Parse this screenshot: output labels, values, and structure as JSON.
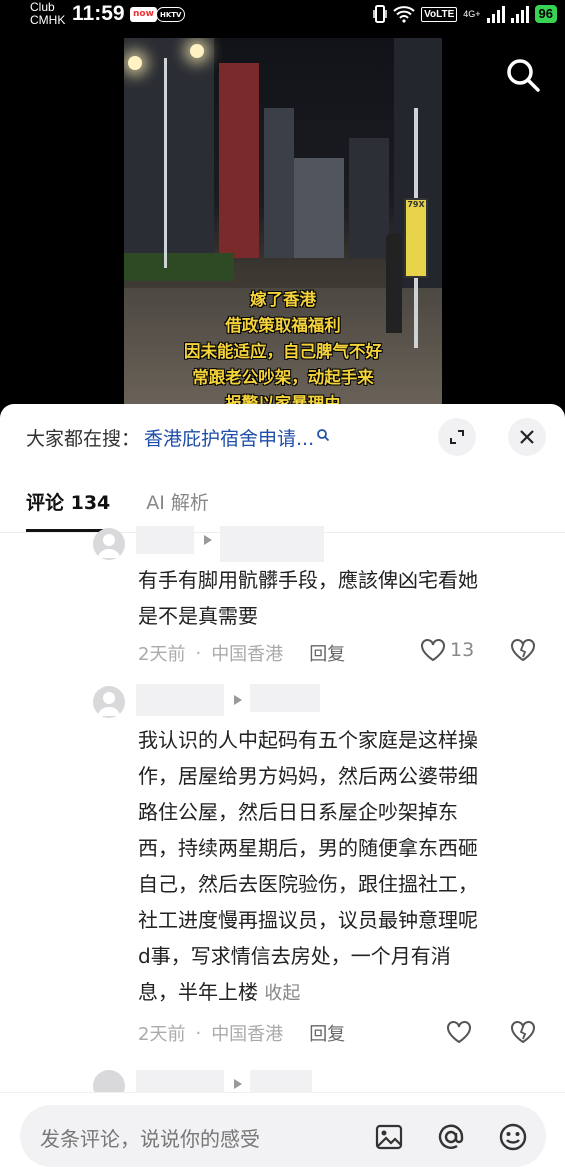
{
  "status_bar": {
    "carrier_line1": "Club",
    "carrier_line2": "CMHK",
    "time": "11:59",
    "app_badge_1": "now",
    "app_badge_2": "HKTV",
    "volte": "VoLTE",
    "network": "4G+",
    "battery": "96"
  },
  "video": {
    "subtitles": [
      "嫁了香港",
      "借政策取福福利",
      "因未能适应，自己脾气不好",
      "常跟老公吵架，动起手来",
      "报警以家暴理由"
    ],
    "sign_text": "79X"
  },
  "sheet": {
    "hot_search_label": "大家都在搜：",
    "hot_search_query": "香港庇护宿舍申请...",
    "tabs": [
      {
        "label": "评论 134",
        "active": true
      },
      {
        "label": "AI 解析",
        "active": false
      }
    ]
  },
  "comments": [
    {
      "text": "有手有脚用骯髒手段，應該俾凶宅看她是不是真需要",
      "line1": "有手有脚用骯髒手段，應該俾凶宅看她",
      "line2": "是不是真需要",
      "time": "2天前",
      "location": "中国香港",
      "reply_label": "回复",
      "likes": "13"
    },
    {
      "lines": [
        "我认识的人中起码有五个家庭是这样操",
        "作，居屋给男方妈妈，然后两公婆带细",
        "路住公屋，然后日日系屋企吵架掉东",
        "西，持续两星期后，男的随便拿东西砸",
        "自己，然后去医院验伤，跟住搵社工，",
        "社工进度慢再搵议员，议员最钟意理呢",
        "d事，写求情信去房处，一个月有消",
        "息，半年上楼"
      ],
      "collapse_label": "收起",
      "time": "2天前",
      "location": "中国香港",
      "reply_label": "回复"
    }
  ],
  "input": {
    "placeholder": "发条评论，说说你的感受"
  },
  "colors": {
    "link_blue": "#1f4fa8",
    "battery_green": "#39d353",
    "subtitle_yellow": "#f5d33a"
  }
}
